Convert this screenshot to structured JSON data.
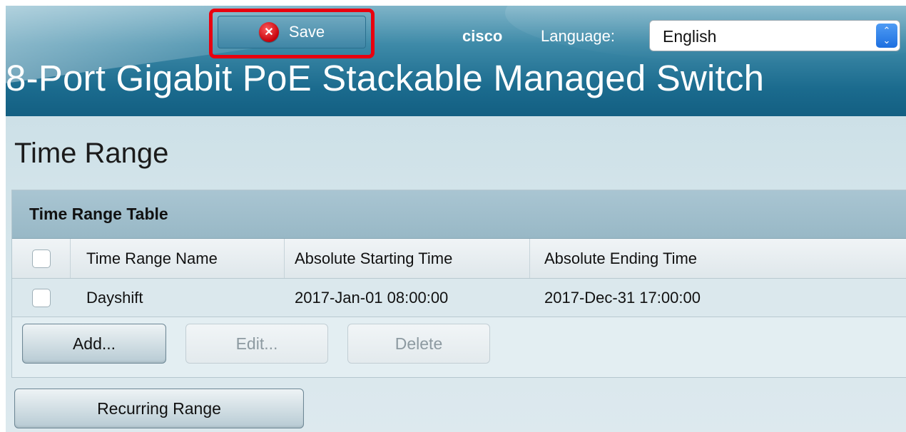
{
  "header": {
    "save_label": "Save",
    "brand": "cisco",
    "language_label": "Language:",
    "language_value": "English",
    "device_title": "8-Port Gigabit PoE Stackable Managed Switch"
  },
  "page": {
    "title": "Time Range"
  },
  "table": {
    "caption": "Time Range Table",
    "columns": [
      "Time Range Name",
      "Absolute Starting Time",
      "Absolute Ending Time"
    ],
    "rows": [
      {
        "name": "Dayshift",
        "start": "2017-Jan-01 08:00:00",
        "end": "2017-Dec-31 17:00:00",
        "selected": false
      }
    ],
    "buttons": {
      "add": "Add...",
      "edit": "Edit...",
      "delete": "Delete"
    }
  },
  "recurring_button": "Recurring Range",
  "colors": {
    "highlight": "#e8000f",
    "header_blue": "#1b6b8e",
    "save_icon": "#c4000a"
  },
  "icons": {
    "save": "close-circle-icon",
    "language_select": "up-down-chevron-icon"
  }
}
